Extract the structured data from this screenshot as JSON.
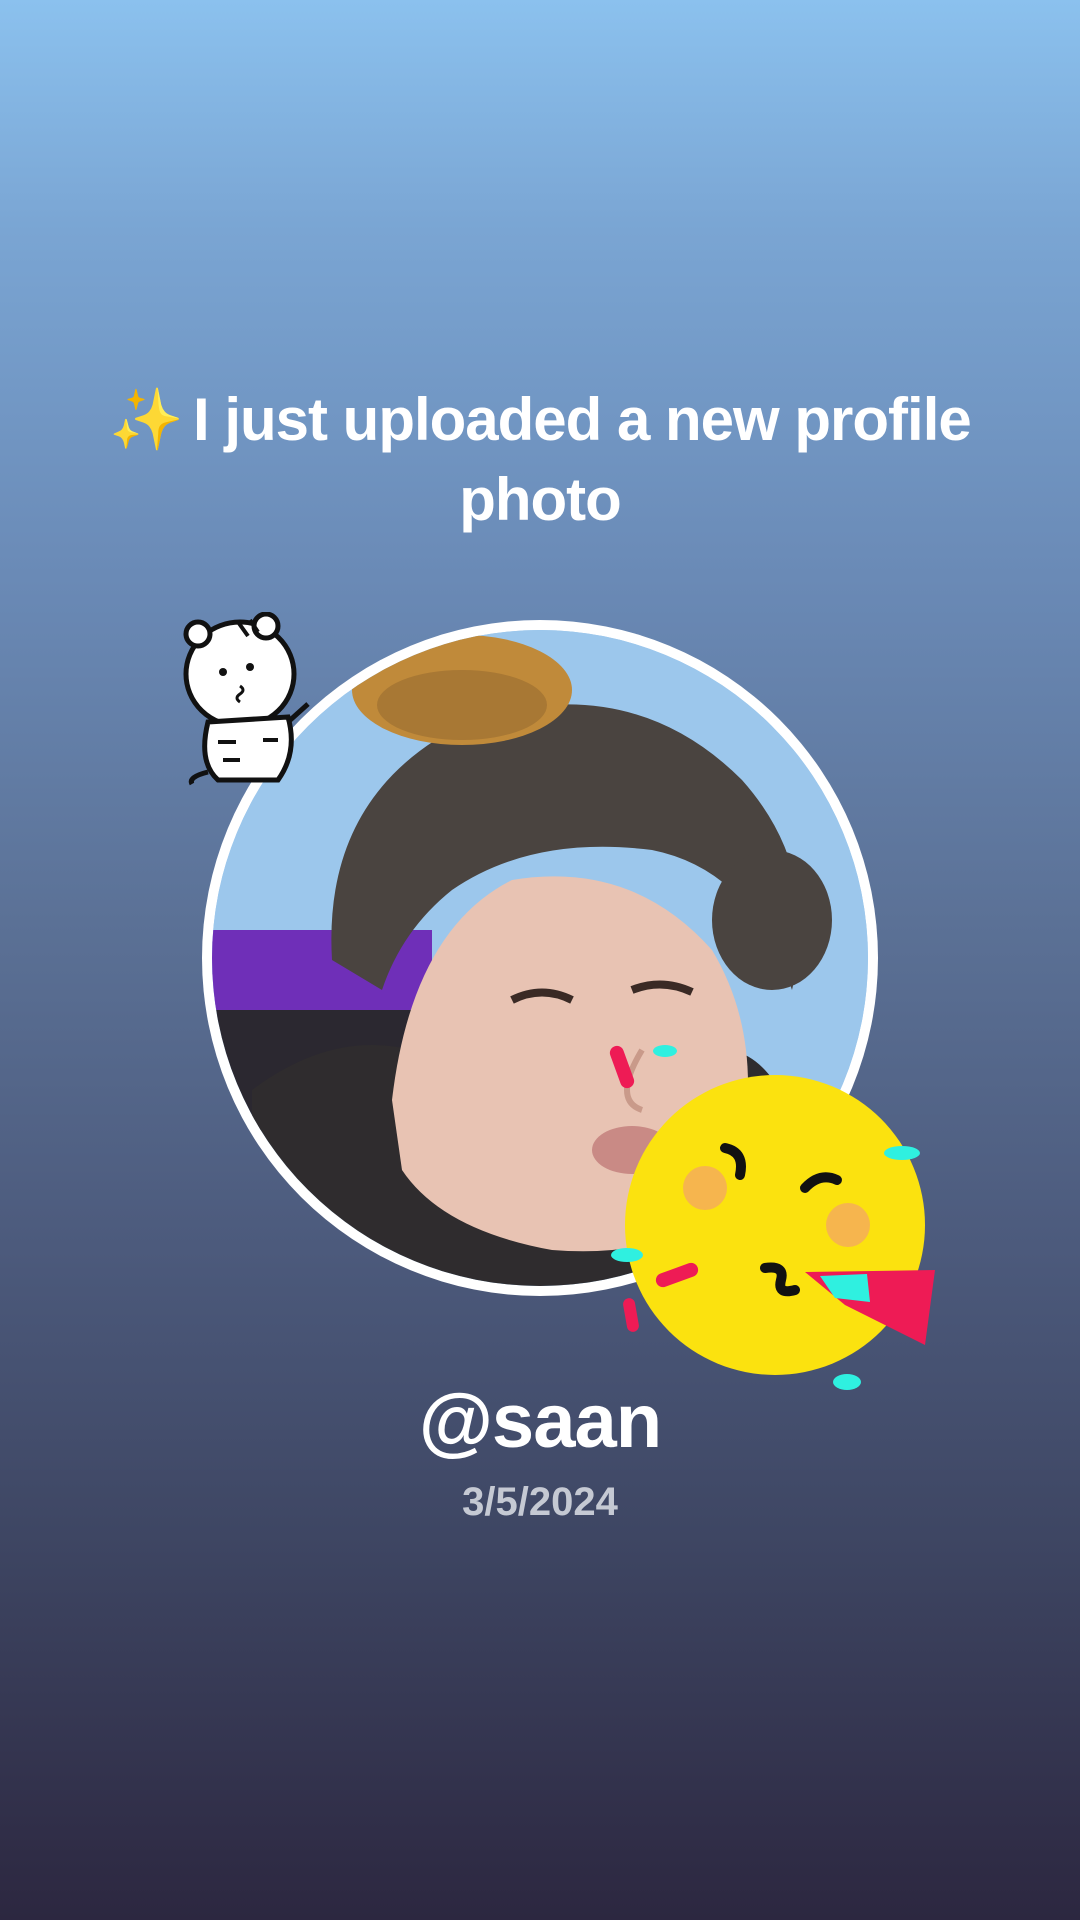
{
  "headline": {
    "sparkle": "✨",
    "text": "I just uploaded a new profile photo"
  },
  "profile": {
    "username": "@saan",
    "date": "3/5/2024"
  },
  "colors": {
    "gradient_top": "#8bc1ee",
    "gradient_bottom": "#2c2740",
    "ring": "#ffffff",
    "date_text": "#c5c9d3",
    "party_face": "#fbe20f"
  },
  "stickers": [
    "tiger-sticker",
    "party-popper-emoji-sticker"
  ]
}
